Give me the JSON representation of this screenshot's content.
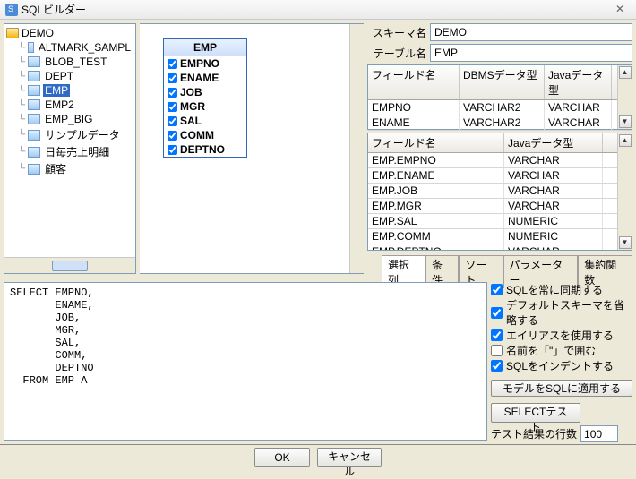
{
  "title": "SQLビルダー",
  "tree": {
    "root": "DEMO",
    "items": [
      "ALTMARK_SAMPL",
      "BLOB_TEST",
      "DEPT",
      "EMP",
      "EMP2",
      "EMP_BIG",
      "サンプルデータ",
      "日毎売上明細",
      "顧客"
    ],
    "selected_index": 3
  },
  "diagram": {
    "header": "EMP",
    "columns": [
      "EMPNO",
      "ENAME",
      "JOB",
      "MGR",
      "SAL",
      "COMM",
      "DEPTNO"
    ]
  },
  "form": {
    "schema_label": "スキーマ名",
    "schema_value": "DEMO",
    "table_label": "テーブル名",
    "table_value": "EMP"
  },
  "grid_top": {
    "headers": [
      "フィールド名",
      "DBMSデータ型",
      "Javaデータ型"
    ],
    "rows": [
      [
        "EMPNO",
        "VARCHAR2",
        "VARCHAR"
      ],
      [
        "ENAME",
        "VARCHAR2",
        "VARCHAR"
      ]
    ]
  },
  "grid_bottom": {
    "headers": [
      "フィールド名",
      "Javaデータ型"
    ],
    "rows": [
      [
        "EMP.EMPNO",
        "VARCHAR"
      ],
      [
        "EMP.ENAME",
        "VARCHAR"
      ],
      [
        "EMP.JOB",
        "VARCHAR"
      ],
      [
        "EMP.MGR",
        "VARCHAR"
      ],
      [
        "EMP.SAL",
        "NUMERIC"
      ],
      [
        "EMP.COMM",
        "NUMERIC"
      ],
      [
        "EMP.DEPTNO",
        "VARCHAR"
      ]
    ]
  },
  "tabs": [
    "選択列",
    "条件",
    "ソート",
    "パラメーター",
    "集約関数"
  ],
  "sql": "SELECT EMPNO,\n       ENAME,\n       JOB,\n       MGR,\n       SAL,\n       COMM,\n       DEPTNO\n  FROM EMP A",
  "options": [
    {
      "label": "SQLを常に同期する",
      "checked": true
    },
    {
      "label": "デフォルトスキーマを省略する",
      "checked": true
    },
    {
      "label": "エイリアスを使用する",
      "checked": true
    },
    {
      "label": "名前を「\"」で囲む",
      "checked": false
    },
    {
      "label": "SQLをインデントする",
      "checked": true
    }
  ],
  "buttons": {
    "apply_model": "モデルをSQLに適用する",
    "select_test": "SELECTテスト"
  },
  "test_row": {
    "label": "テスト結果の行数",
    "value": "100"
  },
  "footer": {
    "ok": "OK",
    "cancel": "キャンセル"
  }
}
